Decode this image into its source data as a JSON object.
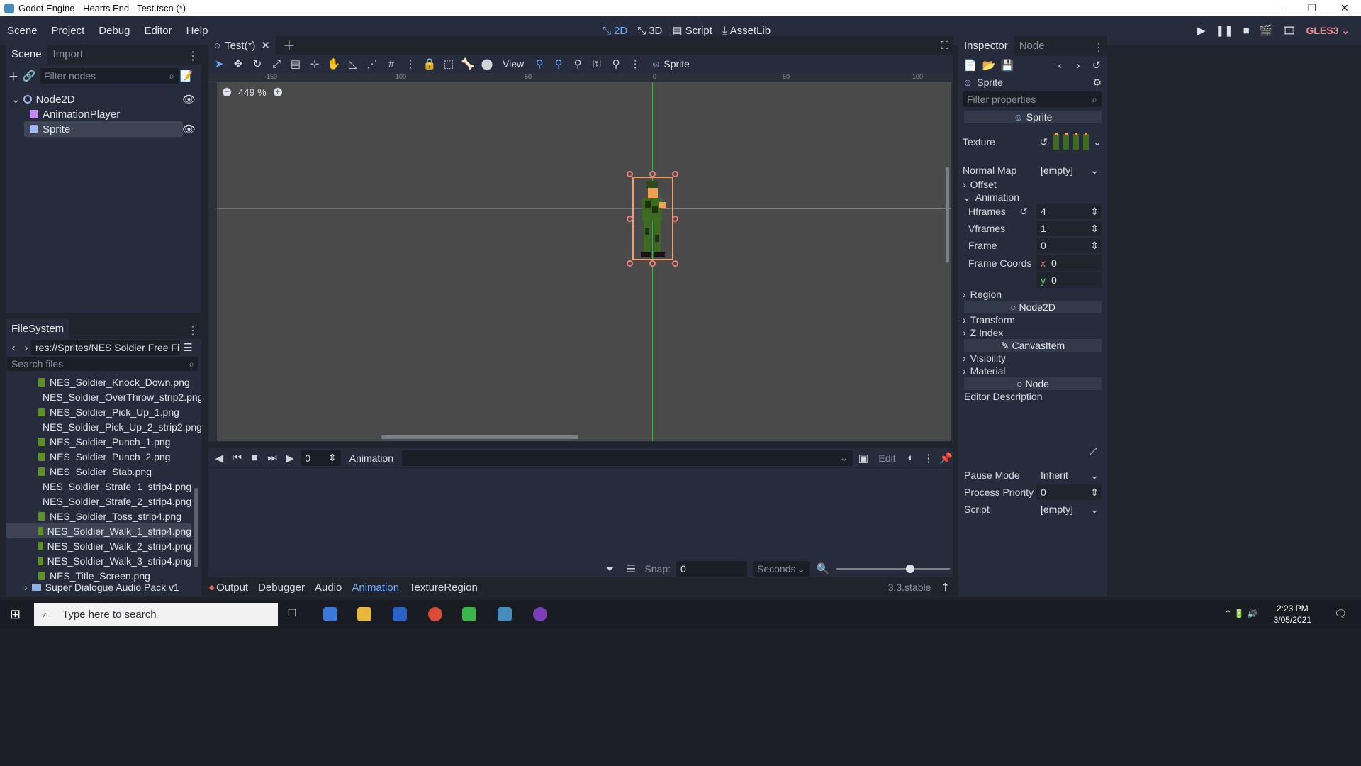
{
  "window": {
    "title": "Godot Engine - Hearts End - Test.tscn (*)",
    "controls": [
      "–",
      "❐",
      "✕"
    ]
  },
  "menu": {
    "items": [
      "Scene",
      "Project",
      "Debug",
      "Editor",
      "Help"
    ]
  },
  "workspaces": {
    "items": [
      "2D",
      "3D",
      "Script",
      "AssetLib"
    ],
    "active": "2D"
  },
  "renderer": "GLES3",
  "scene_dock": {
    "tabs": [
      "Scene",
      "Import"
    ],
    "filter_placeholder": "Filter nodes",
    "tree": [
      {
        "label": "Node2D",
        "selected": false
      },
      {
        "label": "AnimationPlayer",
        "selected": false
      },
      {
        "label": "Sprite",
        "selected": true
      }
    ]
  },
  "filesystem": {
    "tab": "FileSystem",
    "path": "res://Sprites/NES Soldier Free Files/N",
    "search_placeholder": "Search files",
    "files": [
      "NES_Soldier_Knock_Down.png",
      "NES_Soldier_OverThrow_strip2.png",
      "NES_Soldier_Pick_Up_1.png",
      "NES_Soldier_Pick_Up_2_strip2.png",
      "NES_Soldier_Punch_1.png",
      "NES_Soldier_Punch_2.png",
      "NES_Soldier_Stab.png",
      "NES_Soldier_Strafe_1_strip4.png",
      "NES_Soldier_Strafe_2_strip4.png",
      "NES_Soldier_Toss_strip4.png",
      "NES_Soldier_Walk_1_strip4.png",
      "NES_Soldier_Walk_2_strip4.png",
      "NES_Soldier_Walk_3_strip4.png",
      "NES_Title_Screen.png"
    ],
    "selected_file": "NES_Soldier_Walk_1_strip4.png",
    "folder": "Super Dialogue Audio Pack v1"
  },
  "editor": {
    "scene_tab": "Test(*)",
    "toolbar_view": "View",
    "toolbar_sprite": "Sprite",
    "zoom": "449 %",
    "ruler_ticks": [
      "-150",
      "-100",
      "-50",
      "0",
      "50",
      "100"
    ]
  },
  "animation_panel": {
    "frame_value": "0",
    "animation_name": "Animation",
    "edit_label": "Edit",
    "snap_label": "Snap:",
    "snap_value": "0",
    "snap_unit": "Seconds"
  },
  "bottom_tabs": [
    "Output",
    "Debugger",
    "Audio",
    "Animation",
    "TextureRegion"
  ],
  "bottom_active": "Animation",
  "version": "3.3.stable",
  "inspector": {
    "tabs": [
      "Inspector",
      "Node"
    ],
    "object": "Sprite",
    "filter_placeholder": "Filter properties",
    "class_header": "Sprite",
    "texture_label": "Texture",
    "normal_map_label": "Normal Map",
    "normal_map_value": "[empty]",
    "offset_label": "Offset",
    "animation_label": "Animation",
    "hframes_label": "Hframes",
    "hframes_value": "4",
    "vframes_label": "Vframes",
    "vframes_value": "1",
    "frame_label": "Frame",
    "frame_value": "0",
    "frame_coords_label": "Frame Coords",
    "frame_coords_x": "0",
    "frame_coords_y": "0",
    "region_label": "Region",
    "node2d_header": "Node2D",
    "transform_label": "Transform",
    "zindex_label": "Z Index",
    "canvasitem_header": "CanvasItem",
    "visibility_label": "Visibility",
    "material_label": "Material",
    "node_header": "Node",
    "editor_desc_label": "Editor Description",
    "pause_mode_label": "Pause Mode",
    "pause_mode_value": "Inherit",
    "process_priority_label": "Process Priority",
    "process_priority_value": "0",
    "script_label": "Script",
    "script_value": "[empty]"
  },
  "taskbar": {
    "search_placeholder": "Type here to search",
    "time": "2:23 PM",
    "date": "3/05/2021"
  },
  "colors": {
    "accent": "#6fa8ff",
    "bg": "#262c3b",
    "viewport": "#4a4a4a",
    "selection": "#f0a070"
  }
}
